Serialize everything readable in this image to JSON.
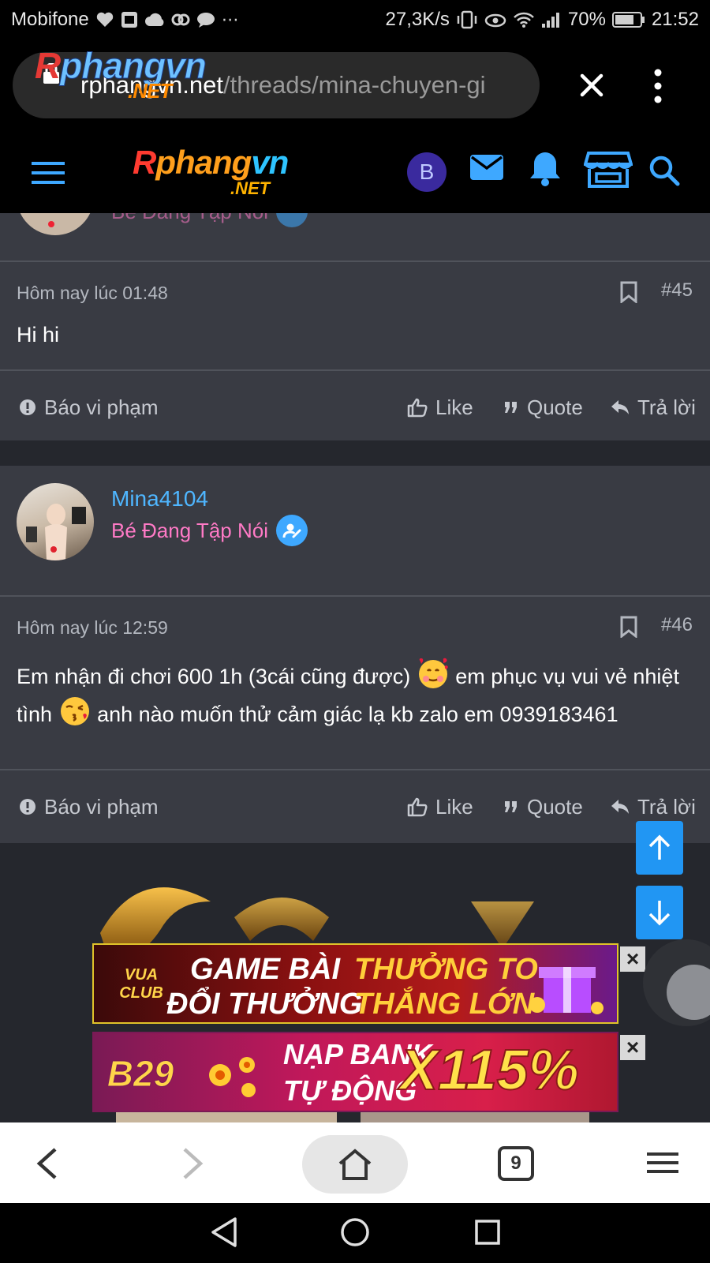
{
  "status_bar": {
    "carrier": "Mobifone",
    "network_speed": "27,3K/s",
    "battery": "70%",
    "time": "21:52"
  },
  "browser": {
    "url_domain": "rphangvn.net",
    "url_path": "/threads/mina-chuyen-gi",
    "tabs_count": "9"
  },
  "site": {
    "logo_main": "Rphangvn",
    "logo_suffix": ".NET",
    "user_initial": "B"
  },
  "posts": [
    {
      "time": "Hôm nay lúc 01:48",
      "number": "#45",
      "text": "Hi hi"
    },
    {
      "author": "Mina4104",
      "user_title": "Bé Đang Tập Nói",
      "time": "Hôm nay lúc 12:59",
      "number": "#46",
      "text_part1": "Em nhận đi chơi 600 1h (3cái cũng được)",
      "text_part2": " em phục vụ vui vẻ nhiệt tình",
      "text_part3": " anh nào muốn thử cảm giác lạ kb zalo em 0939183461"
    }
  ],
  "actions": {
    "report": "Báo vi phạm",
    "like": "Like",
    "quote": "Quote",
    "reply": "Trả lời"
  },
  "ads": [
    {
      "brand": "VUA CLUB",
      "line1": "GAME BÀI",
      "line1b": "THƯỞNG TO",
      "line2": "ĐỔI THƯỞNG",
      "line2b": "THẮNG LỚN",
      "close": "×"
    },
    {
      "brand": "B29",
      "line1": "NẠP BANK",
      "line2": "TỰ ĐỘNG",
      "highlight": "X115%",
      "close": "×"
    }
  ]
}
